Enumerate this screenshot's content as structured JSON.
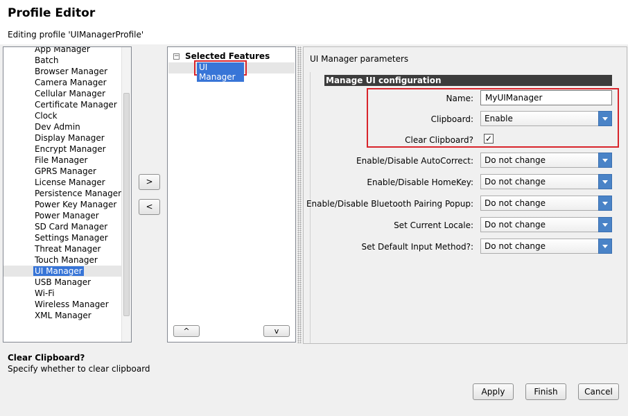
{
  "header": {
    "title": "Profile Editor",
    "subtitle": "Editing profile 'UIManagerProfile'"
  },
  "features_list": {
    "items": [
      {
        "label": "App Manager"
      },
      {
        "label": "Batch"
      },
      {
        "label": "Browser Manager"
      },
      {
        "label": "Camera Manager"
      },
      {
        "label": "Cellular Manager"
      },
      {
        "label": "Certificate Manager"
      },
      {
        "label": "Clock"
      },
      {
        "label": "Dev Admin"
      },
      {
        "label": "Display Manager"
      },
      {
        "label": "Encrypt Manager"
      },
      {
        "label": "File Manager"
      },
      {
        "label": "GPRS Manager"
      },
      {
        "label": "License Manager"
      },
      {
        "label": "Persistence Manager"
      },
      {
        "label": "Power Key Manager"
      },
      {
        "label": "Power Manager"
      },
      {
        "label": "SD Card Manager"
      },
      {
        "label": "Settings Manager"
      },
      {
        "label": "Threat Manager"
      },
      {
        "label": "Touch Manager"
      },
      {
        "label": "UI Manager"
      },
      {
        "label": "USB Manager"
      },
      {
        "label": "Wi-Fi"
      },
      {
        "label": "Wireless Manager"
      },
      {
        "label": "XML Manager"
      }
    ],
    "selected": "UI Manager"
  },
  "transfer": {
    "add_label": ">",
    "remove_label": "<"
  },
  "selected_features": {
    "toggle": "−",
    "root_label": "Selected Features",
    "child_label": "UI Manager",
    "up_label": "^",
    "down_label": "v"
  },
  "params": {
    "panel_label": "UI Manager parameters",
    "section_title": "Manage UI configuration",
    "name_label": "Name:",
    "name_value": "MyUIManager",
    "clipboard_label": "Clipboard:",
    "clipboard_value": "Enable",
    "clear_clipboard_label": "Clear Clipboard?",
    "clear_clipboard_check": "✓",
    "autocorrect_label": "Enable/Disable AutoCorrect:",
    "autocorrect_value": "Do not change",
    "homekey_label": "Enable/Disable HomeKey:",
    "homekey_value": "Do not change",
    "bluetooth_label": "Enable/Disable Bluetooth Pairing Popup:",
    "bluetooth_value": "Do not change",
    "locale_label": "Set Current Locale:",
    "locale_value": "Do not change",
    "input_method_label": "Set Default Input Method?:",
    "input_method_value": "Do not change"
  },
  "help": {
    "title": "Clear Clipboard?",
    "text": "Specify whether to clear clipboard"
  },
  "footer": {
    "apply_label": "Apply",
    "finish_label": "Finish",
    "cancel_label": "Cancel"
  },
  "colors": {
    "selection": "#3875d7",
    "highlight_border": "#d8232a",
    "section_bar": "#3c3c3c",
    "combo_arrow": "#4a83c7"
  }
}
